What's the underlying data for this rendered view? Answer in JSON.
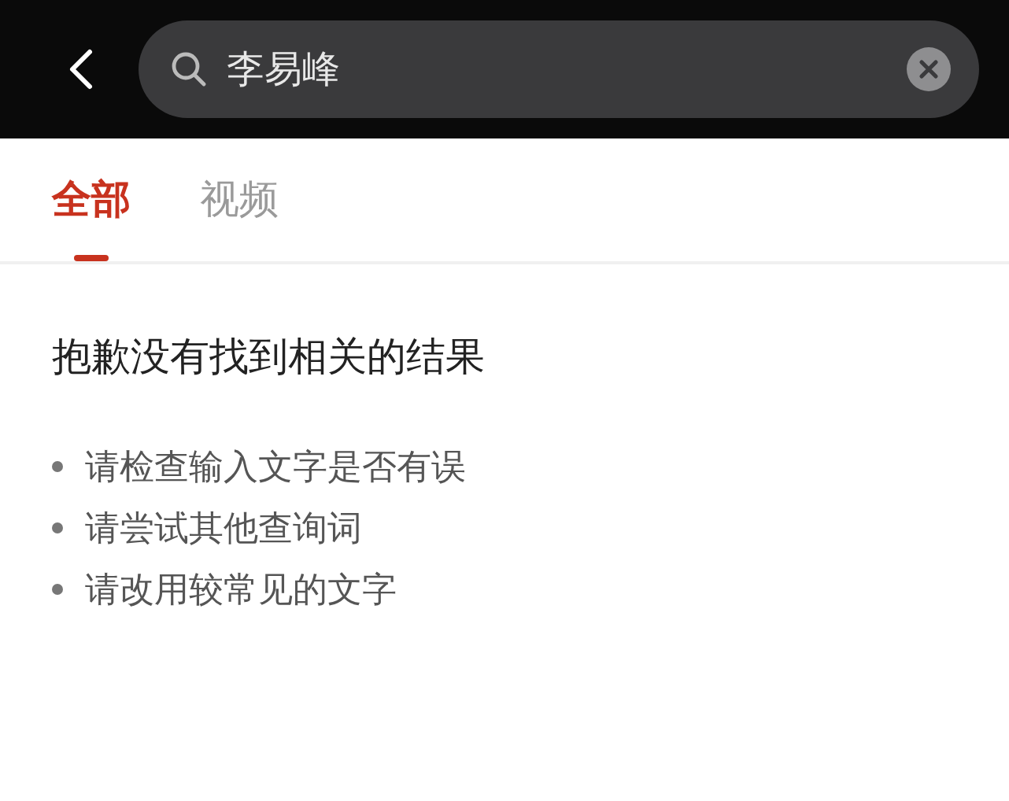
{
  "search": {
    "value": "李易峰"
  },
  "tabs": [
    {
      "label": "全部",
      "selected": true
    },
    {
      "label": "视频",
      "selected": false
    }
  ],
  "message": "抱歉没有找到相关的结果",
  "suggestions": [
    "请检查输入文字是否有误",
    "请尝试其他查询词",
    "请改用较常见的文字"
  ]
}
